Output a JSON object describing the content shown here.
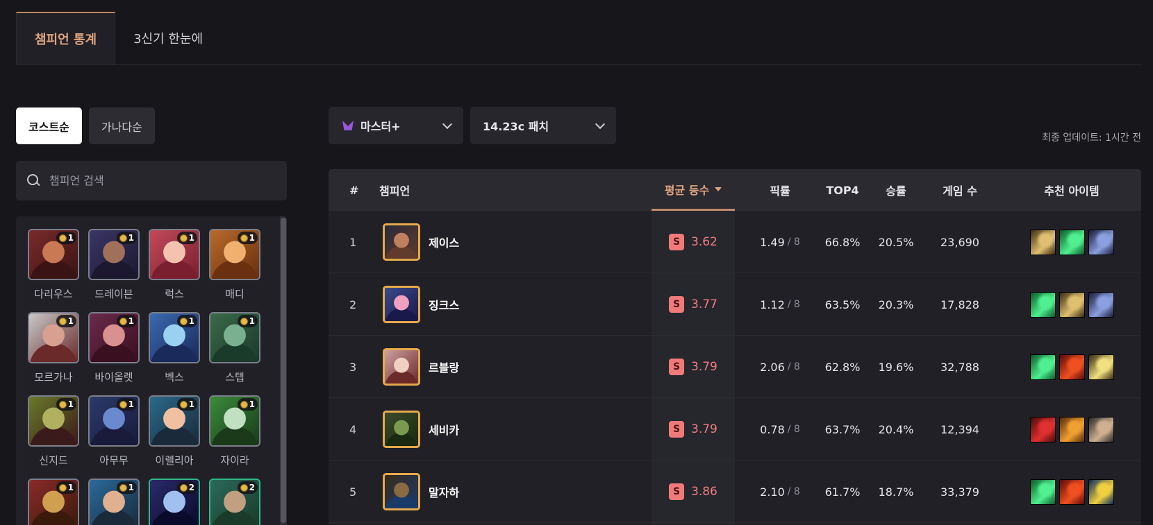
{
  "tabs": [
    {
      "label": "챔피언 통계",
      "active": true
    },
    {
      "label": "3신기 한눈에",
      "active": false
    }
  ],
  "sort": {
    "cost_label": "코스트순",
    "alpha_label": "가나다순"
  },
  "search": {
    "placeholder": "챔피언 검색"
  },
  "champions": [
    {
      "name": "다리우스",
      "cost": "1"
    },
    {
      "name": "드레이븐",
      "cost": "1"
    },
    {
      "name": "럭스",
      "cost": "1"
    },
    {
      "name": "매디",
      "cost": "1"
    },
    {
      "name": "모르가나",
      "cost": "1"
    },
    {
      "name": "바이올렛",
      "cost": "1"
    },
    {
      "name": "벡스",
      "cost": "1"
    },
    {
      "name": "스텝",
      "cost": "1"
    },
    {
      "name": "신지드",
      "cost": "1"
    },
    {
      "name": "아무무",
      "cost": "1"
    },
    {
      "name": "이렐리아",
      "cost": "1"
    },
    {
      "name": "자이라",
      "cost": "1"
    },
    {
      "name": "",
      "cost": "1"
    },
    {
      "name": "",
      "cost": "1"
    },
    {
      "name": "",
      "cost": "2"
    },
    {
      "name": "",
      "cost": "2"
    }
  ],
  "filters": {
    "tier": "마스터+",
    "patch": "14.23c 패치"
  },
  "updated": "최종 업데이트: 1시간 전",
  "table": {
    "headers": {
      "rank": "#",
      "champion": "챔피언",
      "avg": "평균 등수",
      "pick": "픽률",
      "top4": "TOP4",
      "win": "승률",
      "games": "게임 수",
      "items": "추천 아이템"
    },
    "rows": [
      {
        "rank": "1",
        "name": "제이스",
        "tier": "S",
        "avg": "3.62",
        "pick": "1.49",
        "pick_den": "/ 8",
        "top4": "66.8%",
        "win": "20.5%",
        "games": "23,690"
      },
      {
        "rank": "2",
        "name": "징크스",
        "tier": "S",
        "avg": "3.77",
        "pick": "1.12",
        "pick_den": "/ 8",
        "top4": "63.5%",
        "win": "20.3%",
        "games": "17,828"
      },
      {
        "rank": "3",
        "name": "르블랑",
        "tier": "S",
        "avg": "3.79",
        "pick": "2.06",
        "pick_den": "/ 8",
        "top4": "62.8%",
        "win": "19.6%",
        "games": "32,788"
      },
      {
        "rank": "4",
        "name": "세비카",
        "tier": "S",
        "avg": "3.79",
        "pick": "0.78",
        "pick_den": "/ 8",
        "top4": "63.7%",
        "win": "20.4%",
        "games": "12,394"
      },
      {
        "rank": "5",
        "name": "말자하",
        "tier": "S",
        "avg": "3.86",
        "pick": "2.10",
        "pick_den": "/ 8",
        "top4": "61.7%",
        "win": "18.7%",
        "games": "33,379"
      }
    ]
  },
  "colors": {
    "accent": "#e0a47f",
    "tier_s": "#f07a7a",
    "avatar_border": "#e6a94b"
  }
}
